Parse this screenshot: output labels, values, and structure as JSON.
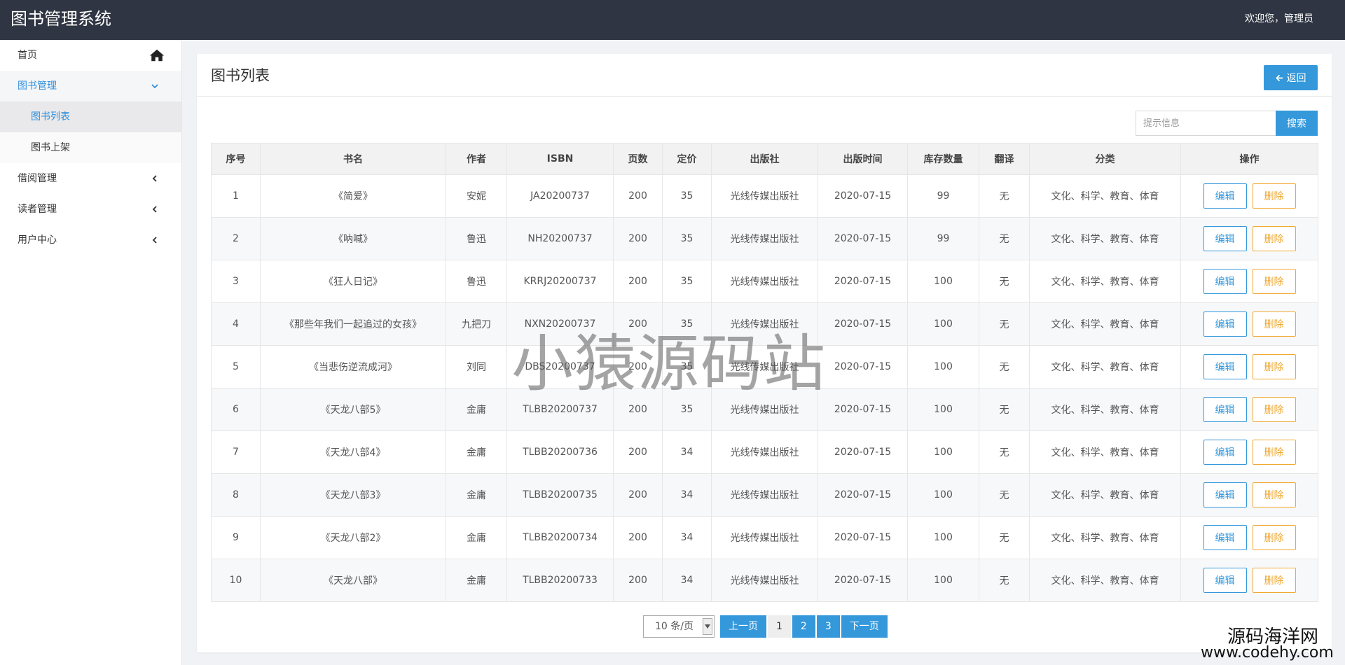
{
  "header": {
    "app_title": "图书管理系统",
    "welcome": "欢迎您，管理员"
  },
  "sidebar": {
    "items": [
      {
        "label": "首页"
      },
      {
        "label": "图书管理"
      },
      {
        "label": "图书列表"
      },
      {
        "label": "图书上架"
      },
      {
        "label": "借阅管理"
      },
      {
        "label": "读者管理"
      },
      {
        "label": "用户中心"
      }
    ]
  },
  "main": {
    "title": "图书列表",
    "back_label": "返回",
    "search": {
      "placeholder": "提示信息",
      "button": "搜索"
    },
    "table": {
      "headers": [
        "序号",
        "书名",
        "作者",
        "ISBN",
        "页数",
        "定价",
        "出版社",
        "出版时间",
        "库存数量",
        "翻译",
        "分类",
        "操作"
      ],
      "edit_label": "编辑",
      "delete_label": "删除",
      "rows": [
        [
          "1",
          "《简爱》",
          "安妮",
          "JA20200737",
          "200",
          "35",
          "光线传媒出版社",
          "2020-07-15",
          "99",
          "无",
          "文化、科学、教育、体育"
        ],
        [
          "2",
          "《呐喊》",
          "鲁迅",
          "NH20200737",
          "200",
          "35",
          "光线传媒出版社",
          "2020-07-15",
          "99",
          "无",
          "文化、科学、教育、体育"
        ],
        [
          "3",
          "《狂人日记》",
          "鲁迅",
          "KRRJ20200737",
          "200",
          "35",
          "光线传媒出版社",
          "2020-07-15",
          "100",
          "无",
          "文化、科学、教育、体育"
        ],
        [
          "4",
          "《那些年我们一起追过的女孩》",
          "九把刀",
          "NXN20200737",
          "200",
          "35",
          "光线传媒出版社",
          "2020-07-15",
          "100",
          "无",
          "文化、科学、教育、体育"
        ],
        [
          "5",
          "《当悲伤逆流成河》",
          "刘同",
          "DBS20200737",
          "200",
          "35",
          "光线传媒出版社",
          "2020-07-15",
          "100",
          "无",
          "文化、科学、教育、体育"
        ],
        [
          "6",
          "《天龙八部5》",
          "金庸",
          "TLBB20200737",
          "200",
          "35",
          "光线传媒出版社",
          "2020-07-15",
          "100",
          "无",
          "文化、科学、教育、体育"
        ],
        [
          "7",
          "《天龙八部4》",
          "金庸",
          "TLBB20200736",
          "200",
          "34",
          "光线传媒出版社",
          "2020-07-15",
          "100",
          "无",
          "文化、科学、教育、体育"
        ],
        [
          "8",
          "《天龙八部3》",
          "金庸",
          "TLBB20200735",
          "200",
          "34",
          "光线传媒出版社",
          "2020-07-15",
          "100",
          "无",
          "文化、科学、教育、体育"
        ],
        [
          "9",
          "《天龙八部2》",
          "金庸",
          "TLBB20200734",
          "200",
          "34",
          "光线传媒出版社",
          "2020-07-15",
          "100",
          "无",
          "文化、科学、教育、体育"
        ],
        [
          "10",
          "《天龙八部》",
          "金庸",
          "TLBB20200733",
          "200",
          "34",
          "光线传媒出版社",
          "2020-07-15",
          "100",
          "无",
          "文化、科学、教育、体育"
        ]
      ]
    },
    "pagination": {
      "page_size": "10 条/页",
      "prev": "上一页",
      "pages": [
        "1",
        "2",
        "3"
      ],
      "current": "1",
      "next": "下一页"
    }
  },
  "watermarks": {
    "center": "小猿源码站",
    "corner_line1": "源码海洋网",
    "corner_line2": "www.codehy.com"
  },
  "colors": {
    "topbar": "#2f3542",
    "primary": "#3498db",
    "warning": "#f0a830",
    "active_text": "#2d8fdc"
  },
  "icons": {
    "home": "home-icon",
    "expanded": "chevron-down-icon",
    "collapsed": "chevron-left-icon",
    "back": "arrow-left-icon"
  }
}
